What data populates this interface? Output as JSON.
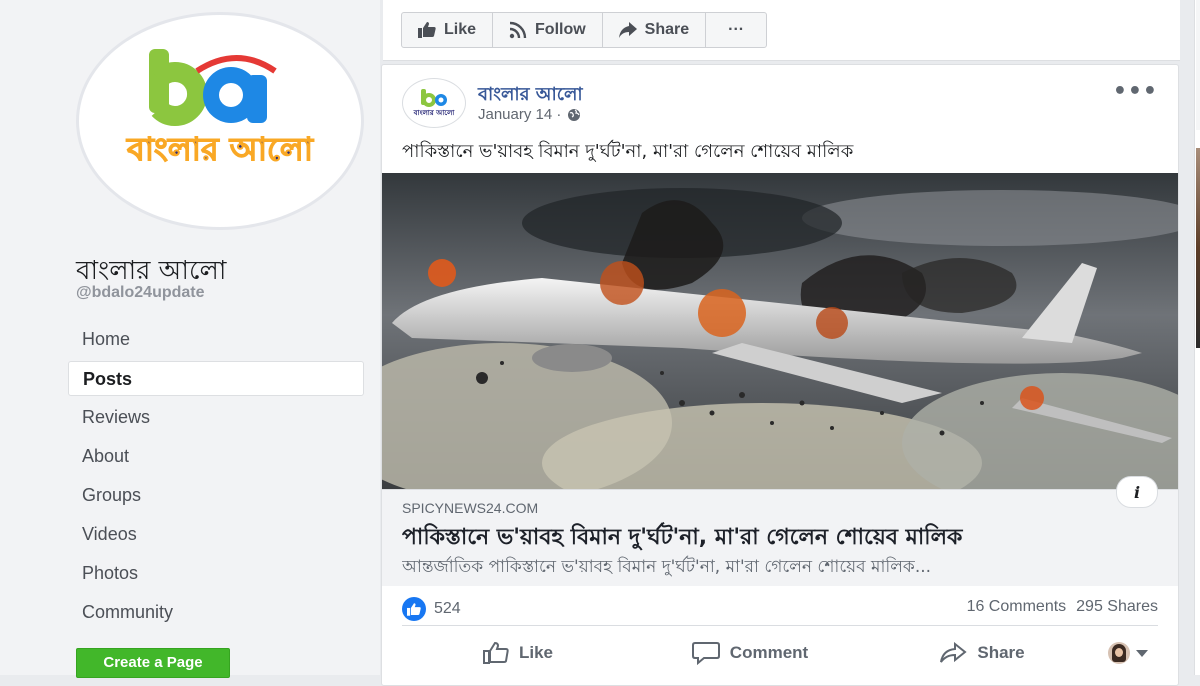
{
  "page": {
    "name": "বাংলার আলো",
    "handle": "@bdalo24update",
    "logo": {
      "mark": "ba",
      "text": "বাংলার আলো",
      "small_text": "বাংলার আলো"
    }
  },
  "sidebar": {
    "items": [
      {
        "label": "Home",
        "active": false
      },
      {
        "label": "Posts",
        "active": true
      },
      {
        "label": "Reviews",
        "active": false
      },
      {
        "label": "About",
        "active": false
      },
      {
        "label": "Groups",
        "active": false
      },
      {
        "label": "Videos",
        "active": false
      },
      {
        "label": "Photos",
        "active": false
      },
      {
        "label": "Community",
        "active": false
      }
    ],
    "create_page_label": "Create a Page"
  },
  "top_actions": {
    "like_label": "Like",
    "follow_label": "Follow",
    "share_label": "Share",
    "more_label": "···"
  },
  "post": {
    "author": "বাংলার আলো",
    "date": "January 14 ·",
    "privacy_icon": "globe-icon",
    "menu_label": "•••",
    "text": "পাকিস্তানে ভ'য়াবহ বিমান দু'র্ঘট'না, মা'রা গেলেন শোয়েব মালিক",
    "link": {
      "domain": "SPICYNEWS24.COM",
      "title": "পাকিস্তানে ভ'য়াবহ বিমান দু'র্ঘট'না, মা'রা গেলেন শোয়েব মালিক",
      "description": "আন্তর্জাতিক  পাকিস্তানে ভ'য়াবহ বিমান দু'র্ঘট'না, মা'রা গেলেন শোয়েব মালিক...",
      "info_label": "i"
    },
    "reactions_count": "524",
    "comments": "16 Comments",
    "shares": "295 Shares",
    "actions": {
      "like": "Like",
      "comment": "Comment",
      "share": "Share"
    }
  },
  "colors": {
    "brand_blue": "#1877f2",
    "link_blue": "#385898",
    "create_green": "#42b72a"
  }
}
